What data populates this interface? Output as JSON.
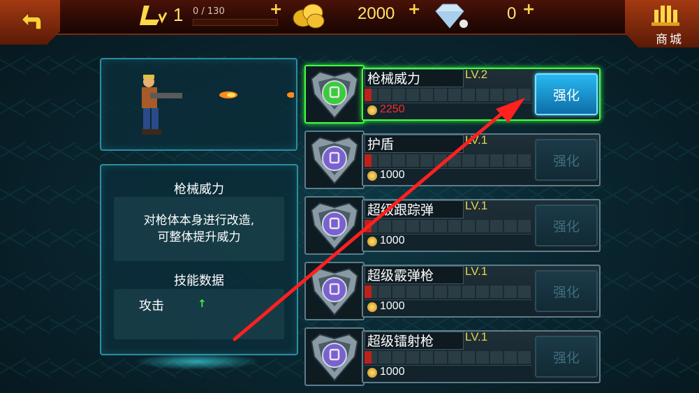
{
  "topbar": {
    "level": "1",
    "xp": "0 / 130",
    "gold": "2000",
    "gems": "0",
    "shop_label": "商城"
  },
  "preview": {},
  "info": {
    "skill_title": "枪械威力",
    "description_line1": "对枪体本身进行改造,",
    "description_line2": "可整体提升威力",
    "data_title": "技能数据",
    "stat_label": "攻击",
    "stat_arrow": "↑"
  },
  "skills": [
    {
      "name": "枪械威力",
      "level": "LV.2",
      "cost": "2250",
      "button": "强化",
      "active": true,
      "progress": 0.04
    },
    {
      "name": "护盾",
      "level": "LV.1",
      "cost": "1000",
      "button": "强化",
      "active": false,
      "progress": 0.04
    },
    {
      "name": "超级跟踪弹",
      "level": "LV.1",
      "cost": "1000",
      "button": "强化",
      "active": false,
      "progress": 0.04
    },
    {
      "name": "超级霰弹枪",
      "level": "LV.1",
      "cost": "1000",
      "button": "强化",
      "active": false,
      "progress": 0.04
    },
    {
      "name": "超级镭射枪",
      "level": "LV.1",
      "cost": "1000",
      "button": "强化",
      "active": false,
      "progress": 0.04
    }
  ],
  "colors": {
    "accent": "#44ff44",
    "button_active": "#28b8f0",
    "cost_red": "#ff2a2a",
    "annotation_arrow": "#ff2020"
  }
}
